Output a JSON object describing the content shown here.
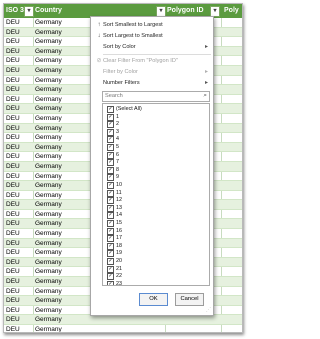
{
  "header": {
    "col1": "ISO 3",
    "col2": "Country",
    "col3": "Polygon ID",
    "col4": "Poly"
  },
  "rows": {
    "iso": "DEU",
    "country": "Germany",
    "count": 33
  },
  "menu": {
    "sort_asc": "Sort Smallest to Largest",
    "sort_desc": "Sort Largest to Smallest",
    "sort_color": "Sort by Color",
    "clear_filter": "Clear Filter From \"Polygon ID\"",
    "filter_color": "Filter by Color",
    "number_filters": "Number Filters",
    "search_placeholder": "Search",
    "select_all": "(Select All)",
    "items": [
      "1",
      "2",
      "3",
      "4",
      "5",
      "6",
      "7",
      "8",
      "9",
      "10",
      "11",
      "12",
      "13",
      "14",
      "15",
      "16",
      "17",
      "18",
      "19",
      "20",
      "21",
      "22",
      "23"
    ],
    "ok": "OK",
    "cancel": "Cancel"
  },
  "icons": {
    "sort_asc": "sort-ascending-icon",
    "sort_desc": "sort-descending-icon",
    "clear_filter": "clear-filter-icon",
    "search": "search-icon",
    "dropdown": "filter-dropdown-icon"
  },
  "colors": {
    "header": "#5b9b3f",
    "row_alt": "#e6f1df"
  }
}
